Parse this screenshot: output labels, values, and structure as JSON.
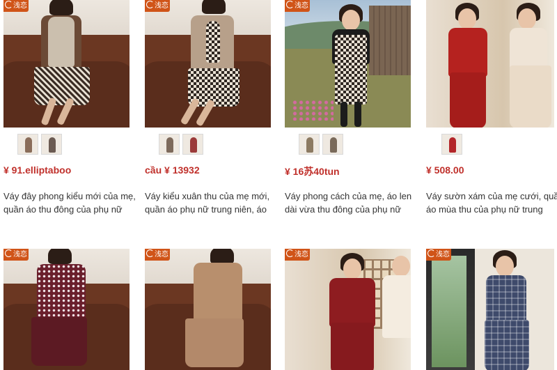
{
  "products": [
    {
      "badge": "浅恋",
      "price": "¥ 91.elliptaboo",
      "description_lines": [
        "Váy đây phong kiểu mới của mẹ,",
        "quần áo thu đông của phụ nữ"
      ],
      "thumbnails": [
        "#8a6d5a",
        "#6b5b52"
      ]
    },
    {
      "badge": "浅恋",
      "price": "cầu ¥ 13932",
      "description_lines": [
        "Váy kiểu xuân thu của mẹ mới,",
        "quần áo phụ nữ trung niên, áo"
      ],
      "thumbnails": [
        "#7d6a5c",
        "#9b3a3a"
      ]
    },
    {
      "badge": "浅恋",
      "price": "¥ 16苏40tun",
      "description_lines": [
        "Váy phong cách của mẹ, áo len",
        "dài vừa thu đông của phụ nữ"
      ],
      "thumbnails": [
        "#8c7a62",
        "#7a6a5a"
      ]
    },
    {
      "badge": "",
      "price": "¥ 508.00",
      "description_lines": [
        "Váy sườn xám của mẹ cưới, quần",
        "áo mùa thu của phụ nữ trung"
      ],
      "thumbnails": [
        "#b3262a"
      ]
    },
    {
      "badge": "浅恋"
    },
    {
      "badge": "浅恋"
    },
    {
      "badge": "浅恋"
    },
    {
      "badge": "浅恋"
    }
  ],
  "colors": {
    "price": "#c0302b",
    "badge": "#d05418",
    "description": "#333333"
  },
  "icons": {
    "badge": "shop-logo-icon"
  }
}
